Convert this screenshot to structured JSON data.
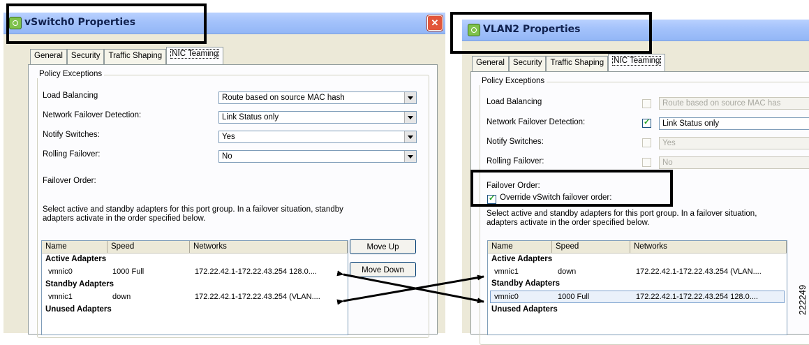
{
  "left_window": {
    "title": "vSwitch0 Properties",
    "close_glyph": "✕",
    "tabs": [
      "General",
      "Security",
      "Traffic Shaping",
      "NIC Teaming"
    ],
    "group_label": "Policy Exceptions",
    "fields": [
      {
        "label": "Load Balancing",
        "value": "Route based on source MAC hash"
      },
      {
        "label": "Network Failover Detection:",
        "value": "Link Status only"
      },
      {
        "label": "Notify Switches:",
        "value": "Yes"
      },
      {
        "label": "Rolling Failover:",
        "value": "No"
      }
    ],
    "failover_order_label": "Failover Order:",
    "description": "Select active and standby adapters for this port group.  In a failover situation, standby adapters activate  in the order specified below.",
    "description_line1": "Select active and standby adapters for this port group.  In a failover situation, standby",
    "description_line2": "adapters activate  in the order specified below.",
    "columns": [
      "Name",
      "Speed",
      "Networks"
    ],
    "sections": {
      "active": "Active Adapters",
      "standby": "Standby Adapters",
      "unused": "Unused Adapters"
    },
    "active_rows": [
      {
        "name": "vmnic0",
        "speed": "1000 Full",
        "networks": "172.22.42.1-172.22.43.254 128.0...."
      }
    ],
    "standby_rows": [
      {
        "name": "vmnic1",
        "speed": "down",
        "networks": "172.22.42.1-172.22.43.254 (VLAN...."
      }
    ],
    "move_up": "Move Up",
    "move_down": "Move Down"
  },
  "right_window": {
    "title": "VLAN2 Properties",
    "tabs": [
      "General",
      "Security",
      "Traffic Shaping",
      "NIC Teaming"
    ],
    "group_label": "Policy Exceptions",
    "fields": [
      {
        "label": "Load Balancing",
        "value": "Route based on source MAC has",
        "checked": false
      },
      {
        "label": "Network Failover Detection:",
        "value": "Link Status only",
        "checked": true
      },
      {
        "label": "Notify Switches:",
        "value": "Yes",
        "checked": false
      },
      {
        "label": "Rolling Failover:",
        "value": "No",
        "checked": false
      }
    ],
    "failover_order_label": "Failover Order:",
    "override_label": "Override vSwitch failover order:",
    "description_line1": "Select active and standby adapters for this port group.  In a failover situation,",
    "description_line2": "adapters activate  in the order specified below.",
    "columns": [
      "Name",
      "Speed",
      "Networks"
    ],
    "sections": {
      "active": "Active Adapters",
      "standby": "Standby Adapters",
      "unused": "Unused Adapters"
    },
    "active_rows": [
      {
        "name": "vmnic1",
        "speed": "down",
        "networks": "172.22.42.1-172.22.43.254 (VLAN...."
      }
    ],
    "standby_rows": [
      {
        "name": "vmnic0",
        "speed": "1000 Full",
        "networks": "172.22.42.1-172.22.43.254 128.0...."
      }
    ]
  },
  "figure_id": "222249",
  "colors": {
    "title_text": "#10214f",
    "close_red": "#e2563b",
    "check_green": "#21a121",
    "callout": "#000000"
  }
}
